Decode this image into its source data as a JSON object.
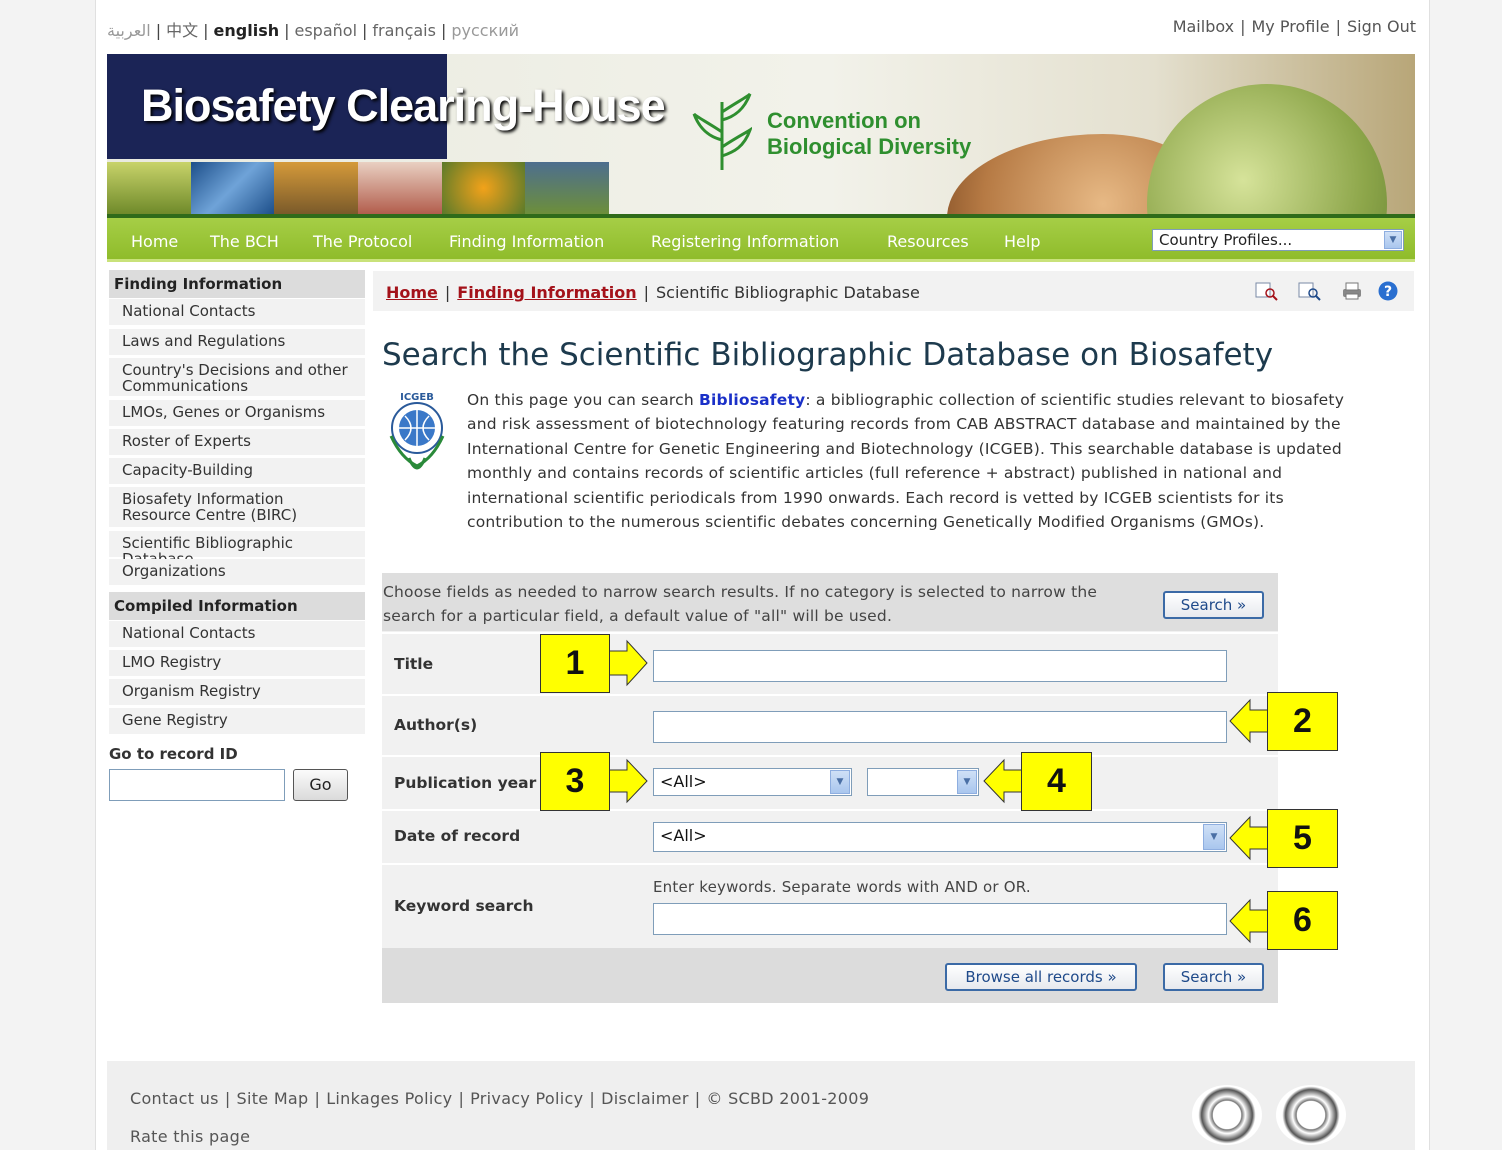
{
  "languages": [
    {
      "label": "العربية",
      "state": "dim"
    },
    {
      "label": "中文",
      "state": "normal"
    },
    {
      "label": "english",
      "state": "current"
    },
    {
      "label": "español",
      "state": "normal"
    },
    {
      "label": "français",
      "state": "normal"
    },
    {
      "label": "русский",
      "state": "dim"
    }
  ],
  "top_links": {
    "mailbox": "Mailbox",
    "profile": "My Profile",
    "signout": "Sign Out"
  },
  "banner": {
    "title": "Biosafety Clearing-House",
    "cbd_line1": "Convention on",
    "cbd_line2": "Biological Diversity"
  },
  "nav": {
    "items": [
      "Home",
      "The BCH",
      "The Protocol",
      "Finding Information",
      "Registering Information",
      "Resources",
      "Help"
    ],
    "country_select": "Country Profiles..."
  },
  "sidebar": {
    "finding_header": "Finding Information",
    "finding_items": [
      "National Contacts",
      "Laws and Regulations",
      "Country's Decisions and other Communications",
      "LMOs, Genes or Organisms",
      "Roster of Experts",
      "Capacity-Building",
      "Biosafety Information Resource Centre (BIRC)",
      "Scientific Bibliographic Database",
      "Organizations"
    ],
    "compiled_header": "Compiled Information",
    "compiled_items": [
      "National Contacts",
      "LMO Registry",
      "Organism Registry",
      "Gene Registry"
    ],
    "goto_label": "Go to record ID",
    "go_button": "Go"
  },
  "breadcrumb": {
    "home": "Home",
    "finding": "Finding Information",
    "current": "Scientific Bibliographic Database"
  },
  "page": {
    "title": "Search the Scientific Bibliographic Database on Biosafety",
    "logo_text": "ICGEB",
    "intro_before": "On this page you can search ",
    "intro_link": "Bibliosafety",
    "intro_after": ": a bibliographic collection of scientific studies relevant to biosafety and risk assessment of biotechnology featuring records from CAB ABSTRACT database and maintained by the International Centre for Genetic Engineering and Biotechnology (ICGEB). This searchable database is updated monthly and contains records of scientific articles (full reference + abstract) published in national and international scientific periodicals from 1990 onwards. Each record is vetted by ICGEB scientists for its contribution to the numerous scientific debates concerning Genetically Modified Organisms (GMOs)."
  },
  "form": {
    "instructions": "Choose fields as needed to narrow search results. If no category is selected to narrow the search for a particular field, a default value of \"all\" will be used.",
    "search_button": "Search »",
    "browse_button": "Browse all records »",
    "title_label": "Title",
    "author_label": "Author(s)",
    "year_label": "Publication year",
    "year_from": "<All>",
    "year_to": "",
    "date_label": "Date of record",
    "date_value": "<All>",
    "keyword_label": "Keyword search",
    "keyword_hint": "Enter keywords. Separate words with AND or OR."
  },
  "callouts": [
    "1",
    "2",
    "3",
    "4",
    "5",
    "6"
  ],
  "footer": {
    "links": [
      "Contact us",
      "Site Map",
      "Linkages Policy",
      "Privacy Policy",
      "Disclaimer",
      "© SCBD 2001-2009"
    ],
    "rate": "Rate this page"
  },
  "colors": {
    "nav_green": "#9ac43a",
    "link_red": "#a4121a",
    "callout_yellow": "#ffff00",
    "button_blue": "#3b6aa6"
  }
}
